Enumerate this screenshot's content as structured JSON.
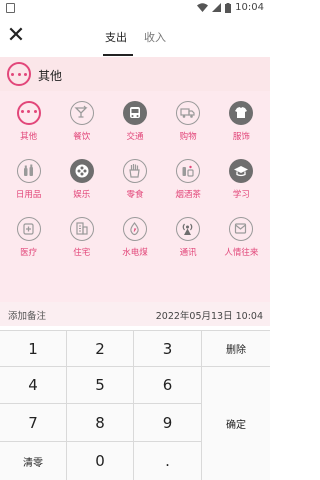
{
  "status_bar": {
    "time": "10:04"
  },
  "header": {
    "tabs": [
      {
        "label": "支出",
        "active": true
      },
      {
        "label": "收入",
        "active": false
      }
    ]
  },
  "selected_category": {
    "name": "其他",
    "icon": "more-dots-icon"
  },
  "categories": [
    {
      "label": "其他",
      "icon": "more-dots-icon",
      "selected": true
    },
    {
      "label": "餐饮",
      "icon": "cocktail-icon"
    },
    {
      "label": "交通",
      "icon": "bus-icon"
    },
    {
      "label": "购物",
      "icon": "truck-icon"
    },
    {
      "label": "服饰",
      "icon": "tshirt-icon"
    },
    {
      "label": "日用品",
      "icon": "bottles-icon"
    },
    {
      "label": "娱乐",
      "icon": "film-reel-icon"
    },
    {
      "label": "零食",
      "icon": "fries-icon"
    },
    {
      "label": "烟酒茶",
      "icon": "tea-cigarette-icon"
    },
    {
      "label": "学习",
      "icon": "graduation-cap-icon"
    },
    {
      "label": "医疗",
      "icon": "medicine-icon"
    },
    {
      "label": "住宅",
      "icon": "building-icon"
    },
    {
      "label": "水电煤",
      "icon": "water-drop-icon"
    },
    {
      "label": "通讯",
      "icon": "signal-tower-icon"
    },
    {
      "label": "人情往来",
      "icon": "envelope-icon"
    }
  ],
  "note": {
    "placeholder": "添加备注",
    "date": "2022年05月13日 10:04"
  },
  "keypad": {
    "rows": [
      [
        "1",
        "2",
        "3",
        "删除"
      ],
      [
        "4",
        "5",
        "6"
      ],
      [
        "7",
        "8",
        "9",
        "确定"
      ],
      [
        "清零",
        "0",
        "."
      ]
    ]
  },
  "colors": {
    "accent": "#e2477a",
    "grid_bg": "#fde9ee",
    "bar_bg": "#fbe6e9"
  }
}
